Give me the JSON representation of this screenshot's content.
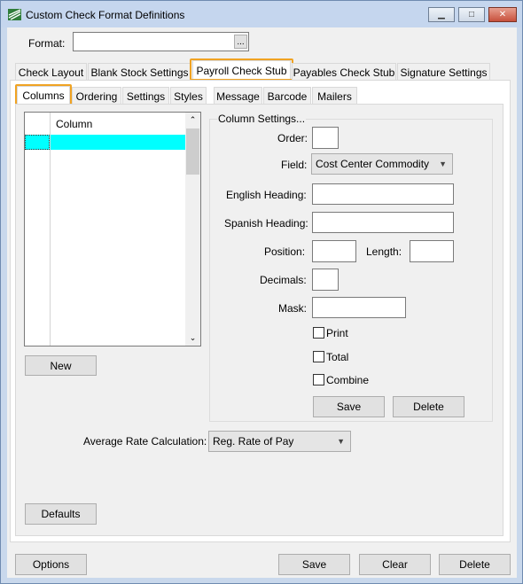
{
  "window": {
    "title": "Custom Check Format Definitions"
  },
  "format": {
    "label": "Format:",
    "value": "",
    "browse": "..."
  },
  "tabs": [
    {
      "label": "Check Layout"
    },
    {
      "label": "Blank Stock Settings"
    },
    {
      "label": "Payroll Check Stub"
    },
    {
      "label": "Payables Check Stub"
    },
    {
      "label": "Signature Settings"
    }
  ],
  "subtabs": [
    {
      "label": "Columns"
    },
    {
      "label": "Ordering"
    },
    {
      "label": "Settings"
    },
    {
      "label": "Styles"
    },
    {
      "label": "Message"
    },
    {
      "label": "Barcode"
    },
    {
      "label": "Mailers"
    }
  ],
  "grid": {
    "header": "Column"
  },
  "new_button": "New",
  "column_settings": {
    "title": "Column Settings...",
    "order_label": "Order:",
    "order_value": "",
    "field_label": "Field:",
    "field_value": "Cost Center Commodity",
    "english_label": "English Heading:",
    "english_value": "",
    "spanish_label": "Spanish Heading:",
    "spanish_value": "",
    "position_label": "Position:",
    "position_value": "",
    "length_label": "Length:",
    "length_value": "",
    "decimals_label": "Decimals:",
    "decimals_value": "",
    "mask_label": "Mask:",
    "mask_value": "",
    "print_label": "Print",
    "total_label": "Total",
    "combine_label": "Combine",
    "save": "Save",
    "delete": "Delete"
  },
  "avg_rate": {
    "label": "Average Rate Calculation:",
    "value": "Reg. Rate of Pay"
  },
  "defaults_button": "Defaults",
  "bottom": {
    "options": "Options",
    "save": "Save",
    "clear": "Clear",
    "delete": "Delete"
  },
  "colors": {
    "accent_highlight": "#f0a323",
    "selected_cell": "#00ffff"
  }
}
